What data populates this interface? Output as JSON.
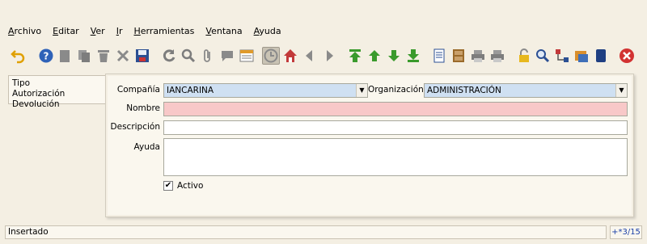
{
  "menu": {
    "items": [
      "Archivo",
      "Editar",
      "Ver",
      "Ir",
      "Herramientas",
      "Ventana",
      "Ayuda"
    ]
  },
  "toolbar": {
    "icons": [
      "undo-icon",
      "help-icon",
      "new-record-icon",
      "copy-record-icon",
      "delete-icon",
      "delete-selection-icon",
      "save-icon",
      "refresh-icon",
      "find-icon",
      "attachment-icon",
      "chat-icon",
      "grid-toggle-icon",
      "history-icon",
      "home-icon",
      "back-icon",
      "forward-icon",
      "first-record-icon",
      "previous-record-icon",
      "next-record-icon",
      "last-record-icon",
      "report-icon",
      "archive-icon",
      "print-preview-icon",
      "print-icon",
      "lock-icon",
      "zoom-across-icon",
      "workflow-icon",
      "product-info-icon",
      "active-workflows-icon",
      "close-window-icon"
    ]
  },
  "tab": {
    "line1": "Tipo",
    "line2": "Autorización Devolución"
  },
  "form": {
    "compania_label": "Compañía",
    "compania_value": "IANCARINA",
    "organizacion_label": "Organización",
    "organizacion_value": "ADMINISTRACIÓN",
    "nombre_label": "Nombre",
    "nombre_value": "",
    "descripcion_label": "Descripción",
    "descripcion_value": "",
    "ayuda_label": "Ayuda",
    "ayuda_value": "",
    "activo_label": "Activo",
    "activo_checked": true
  },
  "status": {
    "message": "Insertado",
    "record_count": "+*3/15"
  },
  "colors": {
    "mandatory_field": "#f8c8c8",
    "readonly_field": "#cfe0f2",
    "background": "#f4efe3"
  }
}
